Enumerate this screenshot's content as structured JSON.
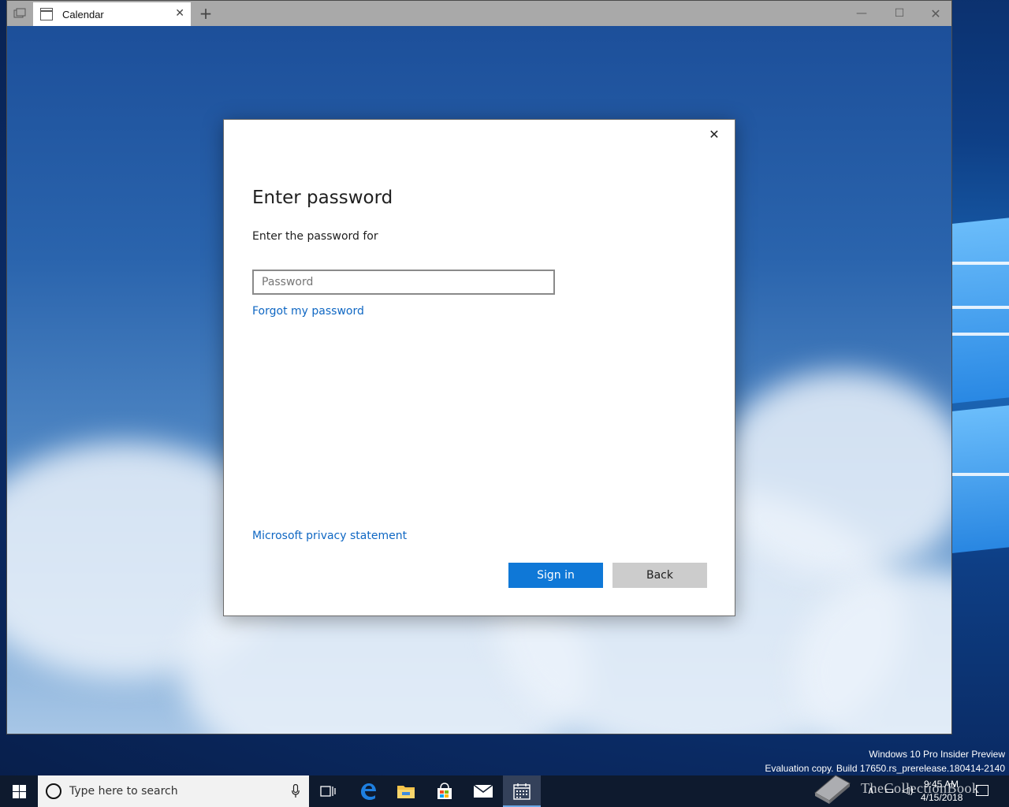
{
  "window": {
    "tab_title": "Calendar",
    "tab_close_glyph": "✕",
    "new_tab_glyph": "+",
    "minimize_glyph": "—",
    "maximize_glyph": "☐",
    "close_glyph": "✕"
  },
  "dialog": {
    "close_glyph": "✕",
    "title": "Enter password",
    "subtitle": "Enter the password for",
    "password_placeholder": "Password",
    "password_value": "",
    "forgot_link": "Forgot my password",
    "privacy_link": "Microsoft privacy statement",
    "signin_label": "Sign in",
    "back_label": "Back",
    "accent_color": "#0f78d7",
    "link_color": "#0f67c3"
  },
  "desktop": {
    "watermark_line1": "Windows 10 Pro Insider Preview",
    "watermark_line2": "Evaluation copy. Build 17650.rs_prerelease.180414-2140"
  },
  "taskbar": {
    "search_placeholder": "Type here to search",
    "clock_time": "9:45 AM",
    "clock_date": "4/15/2018",
    "pinned_icons": [
      "task-view-icon",
      "edge-icon",
      "file-explorer-icon",
      "store-icon",
      "mail-icon",
      "calendar-icon"
    ],
    "tray_icons": [
      "people-icon",
      "chevron-up-icon",
      "network-icon",
      "volume-icon",
      "notification-icon"
    ],
    "overlay_text": "TheCollectionBook"
  }
}
